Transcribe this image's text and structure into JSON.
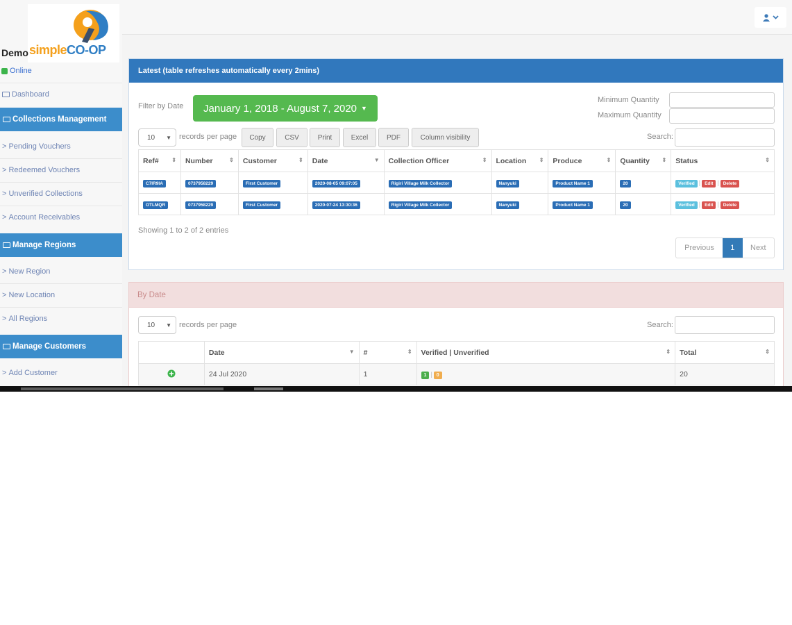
{
  "brand": {
    "logo_part1": "simple",
    "logo_part2": "CO-OP",
    "name": "Demo",
    "status": "Online"
  },
  "colors": {
    "primary": "#3178bd",
    "sidebar_head": "#3c8dcb",
    "success": "#55b94f",
    "danger": "#d9534f",
    "info": "#5bc0de",
    "warning": "#f0ad4e",
    "badge": "#2a6db5"
  },
  "sidebar": {
    "dashboard": "Dashboard",
    "groups": [
      {
        "title": "Collections Management",
        "items": [
          "Pending Vouchers",
          "Redeemed Vouchers",
          "Unverified Collections",
          "Account Receivables"
        ]
      },
      {
        "title": "Manage Regions",
        "items": [
          "New Region",
          "New Location",
          "All Regions"
        ]
      },
      {
        "title": "Manage Customers",
        "items": [
          "Add Customer"
        ]
      }
    ]
  },
  "latest": {
    "title": "Latest (table refreshes automatically every 2mins)",
    "filter_label": "Filter by Date",
    "date_range": "January 1, 2018 - August 7, 2020",
    "min_qty_label": "Minimum Quantity",
    "max_qty_label": "Maximum Quantity",
    "page_size": "10",
    "records_label": "records per page",
    "buttons": [
      "Copy",
      "CSV",
      "Print",
      "Excel",
      "PDF",
      "Column visibility"
    ],
    "search_label": "Search:",
    "columns": [
      "Ref#",
      "Number",
      "Customer",
      "Date",
      "Collection Officer",
      "Location",
      "Produce",
      "Quantity",
      "Status"
    ],
    "rows": [
      [
        "C7IR9IA",
        "0737958229",
        "First Customer",
        "2020-08-05 09:07:05",
        "Rigiri Village Milk Collector",
        "Nanyuki",
        "Product Name 1",
        "20"
      ],
      [
        "OTLMQR",
        "0737958229",
        "First Customer",
        "2020-07-24 13:30:36",
        "Rigiri Village Milk Collector",
        "Nanyuki",
        "Product Name 1",
        "20"
      ]
    ],
    "status_actions": {
      "verified": "Verified",
      "edit": "Edit",
      "delete": "Delete"
    },
    "info": "Showing 1 to 2 of 2 entries",
    "pager": {
      "prev": "Previous",
      "current": "1",
      "next": "Next"
    }
  },
  "by_date": {
    "title": "By Date",
    "page_size": "10",
    "records_label": "records per page",
    "search_label": "Search:",
    "columns": [
      "",
      "Date",
      "#",
      "Verified | Unverified",
      "Total"
    ],
    "rows": [
      {
        "date": "24 Jul 2020",
        "count": "1",
        "verified": "1",
        "unverified": "0",
        "total": "20"
      }
    ]
  },
  "icons": {
    "user": "user-icon",
    "expand": "plus-circle-icon"
  }
}
